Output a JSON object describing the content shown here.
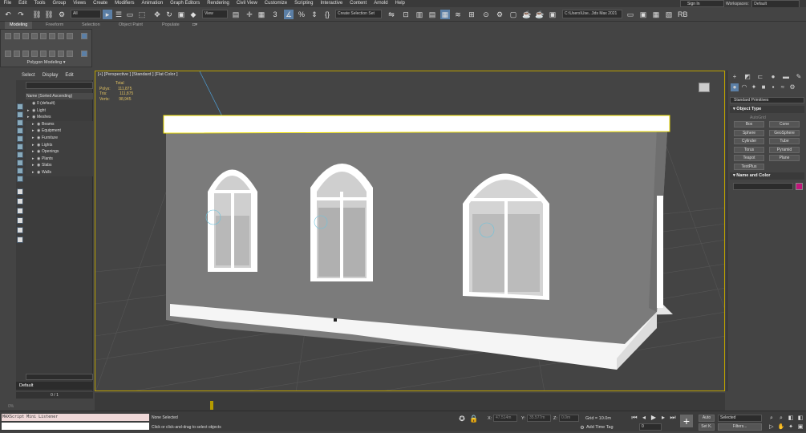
{
  "menu": {
    "items": [
      "File",
      "Edit",
      "Tools",
      "Group",
      "Views",
      "Create",
      "Modifiers",
      "Animation",
      "Graph Editors",
      "Rendering",
      "Civil View",
      "Customize",
      "Scripting",
      "Interactive",
      "Content",
      "Arnold",
      "Help"
    ],
    "sign_in": "Sign In",
    "workspaces_label": "Workspaces:",
    "workspace_value": "Default"
  },
  "toolbar": {
    "filter_value": "All",
    "view_value": "View",
    "selection_set": "Create Selection Set",
    "path_value": "C:\\Users\\Use...3ds Max 2021"
  },
  "ribbon": {
    "tabs": [
      "Modeling",
      "Freeform",
      "Selection",
      "Object Paint",
      "Populate"
    ],
    "panel_label": "Polygon Modeling"
  },
  "scene_explorer": {
    "menu": [
      "Select",
      "Display",
      "Edit"
    ],
    "column_header": "Name (Sorted Ascending)",
    "rows": [
      {
        "label": "0 (default)",
        "indent": 0
      },
      {
        "label": "Light",
        "indent": 0
      },
      {
        "label": "Meshes",
        "indent": 0
      },
      {
        "label": "Beams",
        "indent": 1
      },
      {
        "label": "Equipment",
        "indent": 1
      },
      {
        "label": "Furniture",
        "indent": 1
      },
      {
        "label": "Lights",
        "indent": 1
      },
      {
        "label": "Openings",
        "indent": 1
      },
      {
        "label": "Plants",
        "indent": 1
      },
      {
        "label": "Slabs",
        "indent": 1
      },
      {
        "label": "Walls",
        "indent": 1
      }
    ],
    "layer": "Default",
    "frame_count": "0 / 1"
  },
  "viewport": {
    "label": "[+] [Perspective ] [Standard ] [Flat Color ]",
    "stats": {
      "total_label": "Total",
      "polys_label": "Polys:",
      "polys_value": "111,875",
      "tris_label": "Tris:",
      "tris_value": "111,875",
      "verts_label": "Verts:",
      "verts_value": "98,945"
    }
  },
  "command_panel": {
    "category": "Standard Primitives",
    "object_type_title": "Object Type",
    "autogrid": "AutoGrid",
    "primitives": [
      "Box",
      "Cone",
      "Sphere",
      "GeoSphere",
      "Cylinder",
      "Tube",
      "Torus",
      "Pyramid",
      "Teapot",
      "Plane",
      "TextPlus"
    ],
    "name_color_title": "Name and Color",
    "swatch_color": "#c0167a"
  },
  "status": {
    "maxscript": "MAXScript Mini Listener",
    "selection": "None Selected",
    "prompt": "Click or click-and-drag to select objects",
    "x_label": "X:",
    "x_value": "47.514m",
    "y_label": "Y:",
    "y_value": "35.577m",
    "z_label": "Z:",
    "z_value": "0.0m",
    "grid": "Grid = 10.0m",
    "add_time_tag": "Add Time Tag",
    "frame": "0",
    "auto": "Auto",
    "set_key": "Set K.",
    "selected": "Selected",
    "filters": "Filters...",
    "percent": "0%"
  }
}
